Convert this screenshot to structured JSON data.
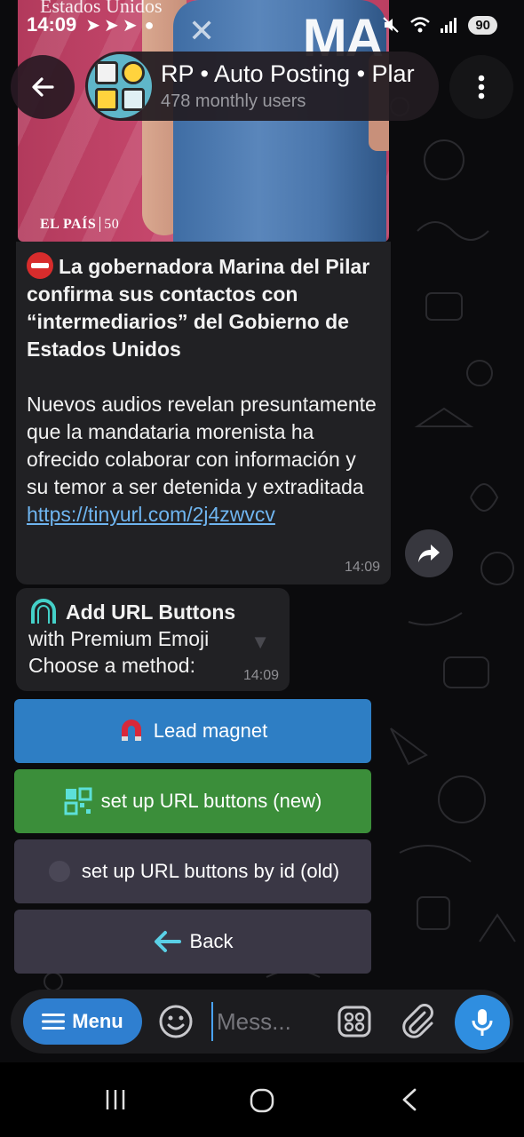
{
  "status_bar": {
    "time": "14:09",
    "battery": "90",
    "notification_icons": [
      "telegram-icon",
      "telegram-icon",
      "telegram-icon"
    ],
    "system_icons": [
      "mute-icon",
      "wifi-icon",
      "signal-icon"
    ]
  },
  "header": {
    "title": "RP • Auto Posting • Plar",
    "subtitle": "478 monthly users"
  },
  "photo": {
    "top_text": "Estados Unidos",
    "overlay_text": "MA",
    "brand": "EL PAÍS",
    "brand_num": "50"
  },
  "message": {
    "headline": "La gobernadora Marina del Pilar confirma sus contactos con “intermediarios” del Gobierno de Estados Unidos",
    "body": "Nuevos audios revelan presuntamente que la mandataria morenista ha ofrecido colaborar con información y su temor a ser detenida y extraditada",
    "link": "https://tinyurl.com/2j4zwvcv",
    "time": "14:09"
  },
  "bot_message": {
    "title": "Add URL Buttons",
    "line1": "with Premium Emoji",
    "line2": "Choose a method:",
    "time": "14:09"
  },
  "keyboard": {
    "lead_magnet": "Lead magnet",
    "setup_new": "set up URL buttons (new)",
    "setup_old": "set up URL buttons by id (old)",
    "back": "Back"
  },
  "input_bar": {
    "menu_label": "Menu",
    "placeholder": "Mess..."
  },
  "colors": {
    "lead_button": "#2e7ec4",
    "new_button": "#3b8e3a",
    "neutral_button": "#3a3745",
    "link": "#6fb5f0",
    "accent": "#2f8ee0"
  }
}
